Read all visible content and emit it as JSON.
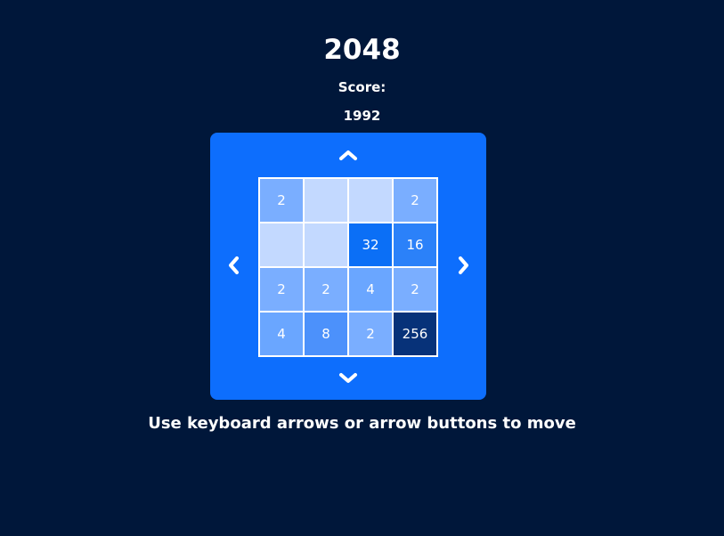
{
  "game": {
    "title": "2048",
    "score_label": "Score:",
    "score_value": "1992",
    "instructions": "Use keyboard arrows or arrow buttons to move"
  },
  "controls": {
    "icons": {
      "up": "chevron-up-icon",
      "down": "chevron-down-icon",
      "left": "chevron-left-icon",
      "right": "chevron-right-icon"
    }
  },
  "board": {
    "rows": [
      [
        "2",
        "",
        "",
        "2"
      ],
      [
        "",
        "",
        "32",
        "16"
      ],
      [
        "2",
        "2",
        "4",
        "2"
      ],
      [
        "4",
        "8",
        "2",
        "256"
      ]
    ]
  },
  "colors": {
    "background": "#00173a",
    "panel": "#0d6efd",
    "empty": "#c3d9ff",
    "2": "#7aaeff",
    "4": "#6aa6ff",
    "8": "#4c91fb",
    "16": "#2b81f9",
    "32": "#0b6ff6",
    "256": "#073279"
  }
}
